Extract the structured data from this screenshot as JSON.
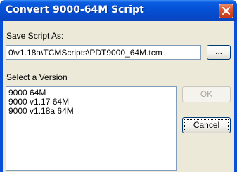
{
  "window": {
    "title": "Convert 9000-64M Script",
    "close_icon": "close-icon"
  },
  "save": {
    "label": "Save Script As:",
    "path_value": "0\\v1.18a\\TCMScripts\\PDT9000_64M.tcm",
    "browse_label": "..."
  },
  "version": {
    "label": "Select a Version",
    "items": [
      "9000 64M",
      "9000 v1.17 64M",
      "9000 v1.18a 64M"
    ]
  },
  "buttons": {
    "ok_label": "OK",
    "ok_enabled": false,
    "cancel_label": "Cancel"
  },
  "colors": {
    "titlebar": "#0551d6",
    "client_bg": "#ece9d8",
    "close_button": "#d9532a"
  }
}
